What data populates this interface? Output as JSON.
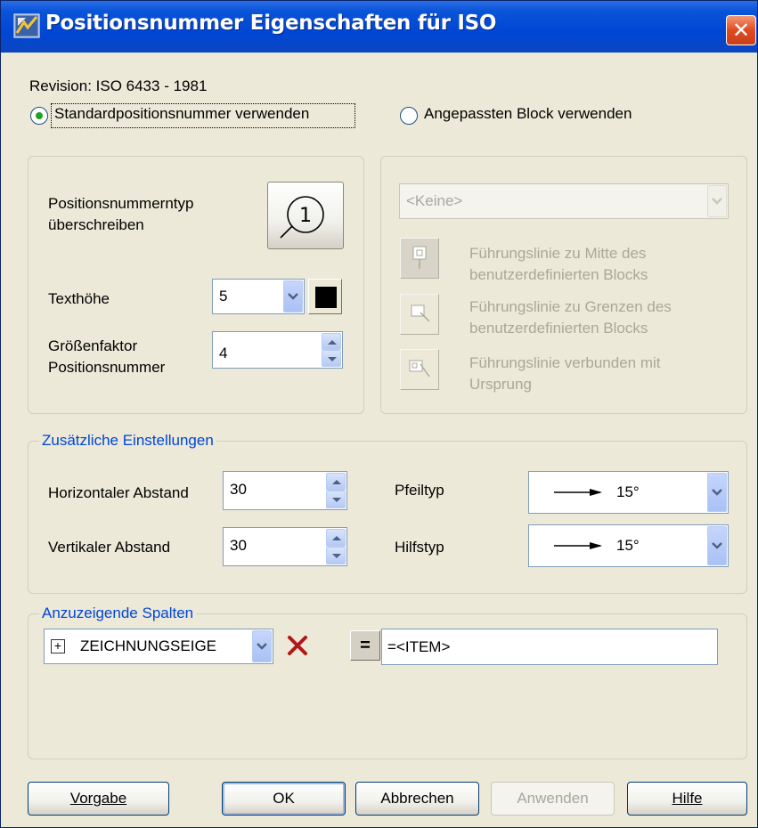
{
  "window": {
    "title": "Positionsnummer Eigenschaften für ISO",
    "close_symbol": "✕"
  },
  "revision_text": "Revision: ISO 6433 - 1981",
  "radio_standard": {
    "label": "Standardpositionsnummer verwenden",
    "checked": true
  },
  "radio_custom": {
    "label": "Angepassten Block verwenden",
    "checked": false
  },
  "left_panel": {
    "override_label_line1": "Positionsnummerntyp",
    "override_label_line2": "überschreiben",
    "balloon_preview_text": "1",
    "text_height_label": "Texthöhe",
    "text_height_value": "5",
    "scale_label_line1": "Größenfaktor",
    "scale_label_line2": "Positionsnummer",
    "scale_value": "4",
    "color_swatch": "#000000"
  },
  "right_panel": {
    "block_select_value": "<Keine>",
    "leader_center_line1": "Führungslinie zu Mitte des",
    "leader_center_line2": "benutzerdefinierten Blocks",
    "leader_bounds_line1": "Führungslinie zu Grenzen des",
    "leader_bounds_line2": "benutzerdefinierten Blocks",
    "leader_origin_line1": "Führungslinie verbunden mit",
    "leader_origin_line2": "Ursprung"
  },
  "additional": {
    "legend": "Zusätzliche Einstellungen",
    "horizontal_label": "Horizontaler Abstand",
    "horizontal_value": "30",
    "vertical_label": "Vertikaler Abstand",
    "vertical_value": "30",
    "arrow_type_label": "Pfeiltyp",
    "arrow_type_value": "15°",
    "aux_type_label": "Hilfstyp",
    "aux_type_value": "15°"
  },
  "columns": {
    "legend": "Anzuzeigende Spalten",
    "tree_expand_symbol": "+",
    "property_select_value": "ZEICHNUNGSEIGE",
    "equals_symbol": "=",
    "expression_value": "=<ITEM>"
  },
  "buttons": {
    "default_label": "Vorgabe",
    "ok_label": "OK",
    "cancel_label": "Abbrechen",
    "apply_label": "Anwenden",
    "help_label": "Hilfe"
  },
  "colors": {
    "titlebar": "#0046d5",
    "legend_text": "#0046d5",
    "dialog_bg": "#ece9d8",
    "delete_icon": "#b01818"
  }
}
